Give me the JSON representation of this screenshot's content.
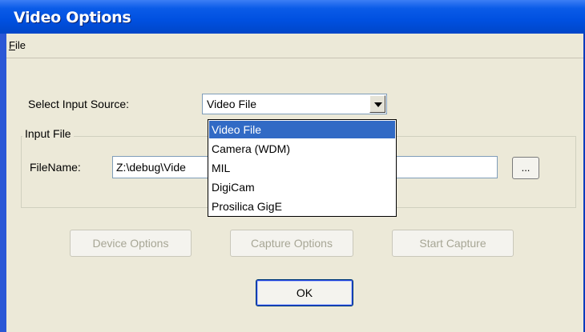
{
  "window": {
    "title": "Video Options"
  },
  "menu": {
    "file_label": "File"
  },
  "input_source": {
    "label": "Select Input Source:",
    "selected": "Video File",
    "options": [
      "Video File",
      "Camera (WDM)",
      "MIL",
      "DigiCam",
      "Prosilica GigE"
    ]
  },
  "input_file": {
    "group_title": "Input File",
    "filename_label": "FileName:",
    "filename_value": "Z:\\debug\\Vide",
    "browse_label": "..."
  },
  "buttons": {
    "device_options": "Device Options",
    "capture_options": "Capture Options",
    "start_capture": "Start Capture",
    "ok": "OK"
  },
  "colors": {
    "titlebar": "#0050e0",
    "window_bg": "#ece9d8",
    "selection": "#316ac5",
    "disabled_text": "#a7a695"
  }
}
